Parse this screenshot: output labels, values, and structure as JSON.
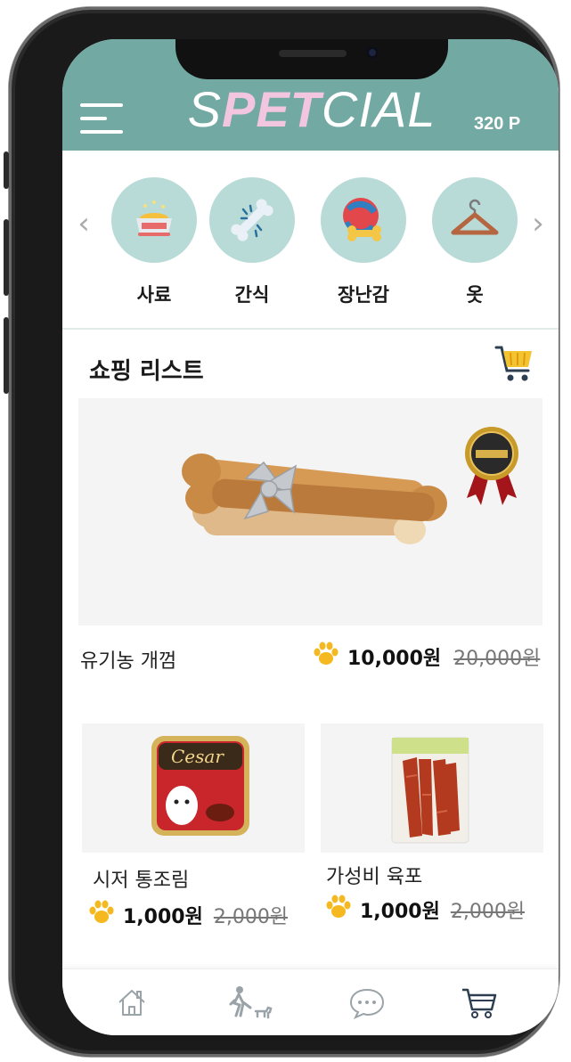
{
  "header": {
    "logo_part1": "S",
    "logo_part2": "PET",
    "logo_part3": "CIAL",
    "points": "320 P",
    "header_color": "#73a9a3",
    "accent_color": "#f1c6de"
  },
  "categories": [
    {
      "label": "사료",
      "icon": "food-bowl-icon"
    },
    {
      "label": "간식",
      "icon": "bone-treat-icon"
    },
    {
      "label": "장난감",
      "icon": "ball-toy-icon"
    },
    {
      "label": "옷",
      "icon": "hanger-icon"
    }
  ],
  "shopping": {
    "title": "쇼핑 리스트",
    "featured": {
      "name": "유기농 개껌",
      "price": "10,000원",
      "original_price": "20,000원",
      "badge_icon": "premium-quality-badge-icon"
    },
    "products": [
      {
        "name": "시저 통조림",
        "price": "1,000원",
        "original_price": "2,000원"
      },
      {
        "name": "가성비 육포",
        "price": "1,000원",
        "original_price": "2,000원"
      }
    ]
  },
  "bottom_nav": [
    {
      "icon": "home-icon"
    },
    {
      "icon": "walk-dog-icon"
    },
    {
      "icon": "chat-icon"
    },
    {
      "icon": "cart-icon"
    }
  ]
}
